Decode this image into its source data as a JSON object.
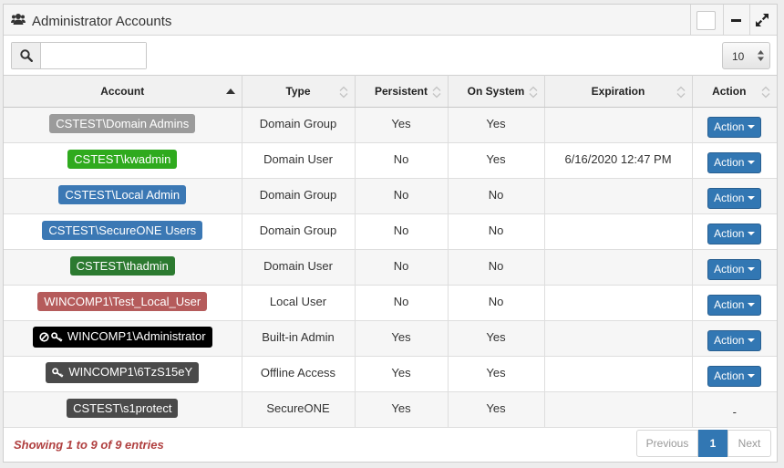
{
  "panel": {
    "title": "Administrator Accounts",
    "icon": "users-icon"
  },
  "toolbar": {
    "search_value": "",
    "page_size": "10"
  },
  "table": {
    "columns": [
      "Account",
      "Type",
      "Persistent",
      "On System",
      "Expiration",
      "Action"
    ],
    "rows": [
      {
        "account": "CSTEST\\Domain Admins",
        "badge_color": "#9b9b9b",
        "icons": [],
        "type": "Domain Group",
        "persistent": "Yes",
        "on_system": "Yes",
        "expiration": "",
        "action": "Action"
      },
      {
        "account": "CSTEST\\kwadmin",
        "badge_color": "#2faa1e",
        "icons": [],
        "type": "Domain User",
        "persistent": "No",
        "on_system": "Yes",
        "expiration": "6/16/2020 12:47 PM",
        "action": "Action"
      },
      {
        "account": "CSTEST\\Local Admin",
        "badge_color": "#3b78b4",
        "icons": [],
        "type": "Domain Group",
        "persistent": "No",
        "on_system": "No",
        "expiration": "",
        "action": "Action"
      },
      {
        "account": "CSTEST\\SecureONE Users",
        "badge_color": "#3b78b4",
        "icons": [],
        "type": "Domain Group",
        "persistent": "No",
        "on_system": "No",
        "expiration": "",
        "action": "Action"
      },
      {
        "account": "CSTEST\\thadmin",
        "badge_color": "#2c7a30",
        "icons": [],
        "type": "Domain User",
        "persistent": "No",
        "on_system": "No",
        "expiration": "",
        "action": "Action"
      },
      {
        "account": "WINCOMP1\\Test_Local_User",
        "badge_color": "#b55b5b",
        "icons": [],
        "type": "Local User",
        "persistent": "No",
        "on_system": "No",
        "expiration": "",
        "action": "Action"
      },
      {
        "account": "WINCOMP1\\Administrator",
        "badge_color": "#000000",
        "icons": [
          "blocked-icon",
          "key-icon"
        ],
        "type": "Built-in Admin",
        "persistent": "Yes",
        "on_system": "Yes",
        "expiration": "",
        "action": "Action"
      },
      {
        "account": "WINCOMP1\\6TzS15eY",
        "badge_color": "#4a4a4a",
        "icons": [
          "key-icon"
        ],
        "type": "Offline Access",
        "persistent": "Yes",
        "on_system": "Yes",
        "expiration": "",
        "action": "Action"
      },
      {
        "account": "CSTEST\\s1protect",
        "badge_color": "#4a4a4a",
        "icons": [],
        "type": "SecureONE",
        "persistent": "Yes",
        "on_system": "Yes",
        "expiration": "",
        "action": "-"
      }
    ]
  },
  "footer": {
    "info": "Showing 1 to 9 of 9 entries",
    "previous": "Previous",
    "current_page": "1",
    "next": "Next"
  },
  "colors": {
    "primary": "#3277b3",
    "info_text": "#b04040"
  }
}
